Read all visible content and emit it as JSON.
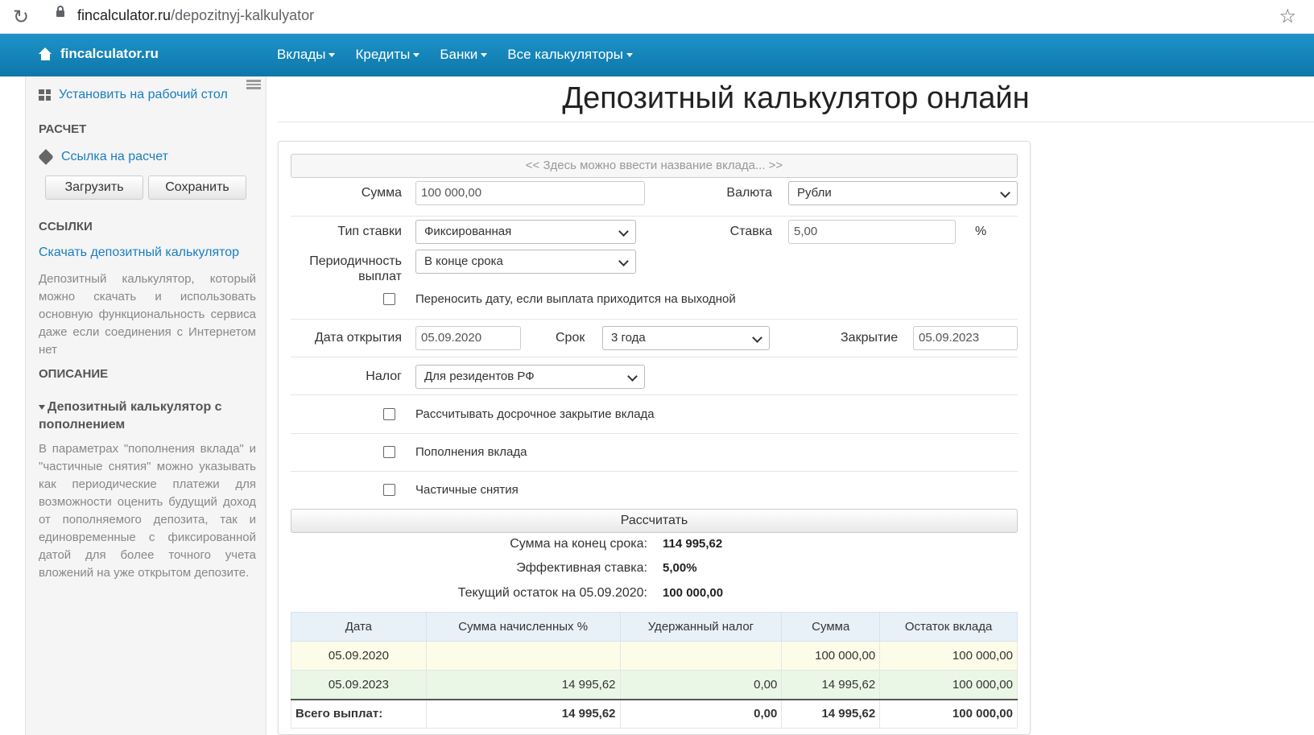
{
  "browser": {
    "url_host": "fincalculator.ru",
    "url_path": "/depozitnyj-kalkulyator"
  },
  "navbar": {
    "brand": "fincalculator.ru",
    "items": [
      {
        "label": "Вклады"
      },
      {
        "label": "Кредиты"
      },
      {
        "label": "Банки"
      },
      {
        "label": "Все калькуляторы"
      }
    ]
  },
  "sidebar": {
    "install_label": "Установить на рабочий стол",
    "calc_heading": "РАСЧЕТ",
    "calc_link": "Ссылка на расчет",
    "load_btn": "Загрузить",
    "save_btn": "Сохранить",
    "links_heading": "ССЫЛКИ",
    "download_link": "Скачать депозитный калькулятор",
    "download_text": "Депозитный калькулятор, который можно скачать и использовать основную функциональность сервиса даже если соединения с Интернетом нет",
    "desc_heading": "ОПИСАНИЕ",
    "desc_sub": "Депозитный калькулятор с пополнением",
    "desc_text": "В параметрах \"пополнения вклада\" и \"частичные снятия\" можно указывать как периодические платежи для возможности оценить будущий доход от пополняемого депозита, так и единовременные с фиксированной датой для более точного учета вложений на уже открытом депозите."
  },
  "page": {
    "title": "Депозитный калькулятор онлайн"
  },
  "form": {
    "deposit_name_placeholder": "<< Здесь можно ввести название вклада... >>",
    "sum_label": "Сумма",
    "sum_value": "100 000,00",
    "currency_label": "Валюта",
    "currency_value": "Рубли",
    "rate_type_label": "Тип ставки",
    "rate_type_value": "Фиксированная",
    "rate_label": "Ставка",
    "rate_value": "5,00",
    "rate_unit": "%",
    "period_label_1": "Периодичность",
    "period_label_2": "выплат",
    "period_value": "В конце срока",
    "move_date_label": "Переносить дату, если выплата приходится на выходной",
    "open_date_label": "Дата открытия",
    "open_date_value": "05.09.2020",
    "term_label": "Срок",
    "term_value": "3 года",
    "close_label": "Закрытие",
    "close_value": "05.09.2023",
    "tax_label": "Налог",
    "tax_value": "Для резидентов РФ",
    "early_close_label": "Рассчитывать досрочное закрытие вклада",
    "refill_label": "Пополнения вклада",
    "withdraw_label": "Частичные снятия",
    "calc_btn": "Рассчитать"
  },
  "results": {
    "end_sum_label": "Сумма на конец срока:",
    "end_sum_value": "114 995,62",
    "eff_rate_label": "Эффективная ставка:",
    "eff_rate_value": "5,00%",
    "current_label": "Текущий остаток на 05.09.2020:",
    "current_value": "100 000,00"
  },
  "table": {
    "headers": [
      "Дата",
      "Сумма начисленных %",
      "Удержанный налог",
      "Сумма",
      "Остаток вклада"
    ],
    "rows": [
      [
        "05.09.2020",
        "",
        "",
        "100 000,00",
        "100 000,00"
      ],
      [
        "05.09.2023",
        "14 995,62",
        "0,00",
        "14 995,62",
        "100 000,00"
      ]
    ],
    "total": [
      "Всего выплат:",
      "14 995,62",
      "0,00",
      "14 995,62",
      "100 000,00"
    ]
  }
}
